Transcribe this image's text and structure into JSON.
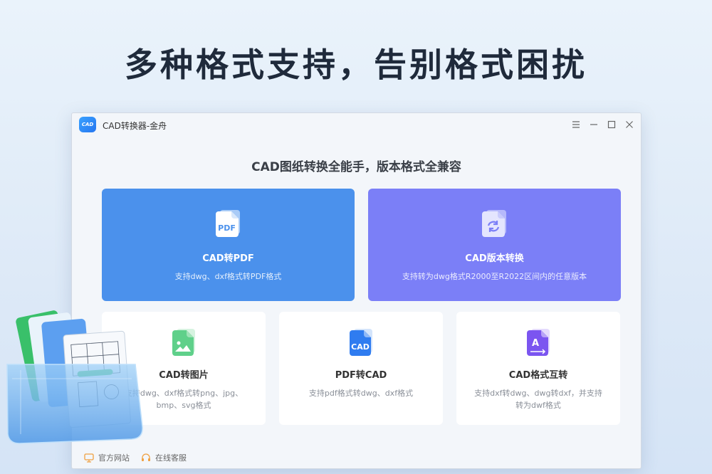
{
  "headline": "多种格式支持，告别格式困扰",
  "window": {
    "title": "CAD转换器-金舟",
    "logo_text": "CAD"
  },
  "subtitle": "CAD图纸转换全能手，版本格式全兼容",
  "cards": {
    "cad_to_pdf": {
      "icon_text": "PDF",
      "title": "CAD转PDF",
      "desc": "支持dwg、dxf格式转PDF格式"
    },
    "cad_version": {
      "title": "CAD版本转换",
      "desc": "支持转为dwg格式R2000至R2022区间内的任意版本"
    },
    "cad_to_image": {
      "title": "CAD转图片",
      "desc": "支持dwg、dxf格式转png、jpg、bmp、svg格式"
    },
    "pdf_to_cad": {
      "icon_text": "CAD",
      "title": "PDF转CAD",
      "desc": "支持pdf格式转dwg、dxf格式"
    },
    "format_convert": {
      "icon_text": "A",
      "title": "CAD格式互转",
      "desc": "支持dxf转dwg、dwg转dxf，并支持转为dwf格式"
    }
  },
  "footer": {
    "official_site": "官方网站",
    "online_service": "在线客服"
  },
  "colors": {
    "blue_card": "#4b91ec",
    "purple_card": "#7b7ff7",
    "footer_icon": "#f0a040"
  }
}
